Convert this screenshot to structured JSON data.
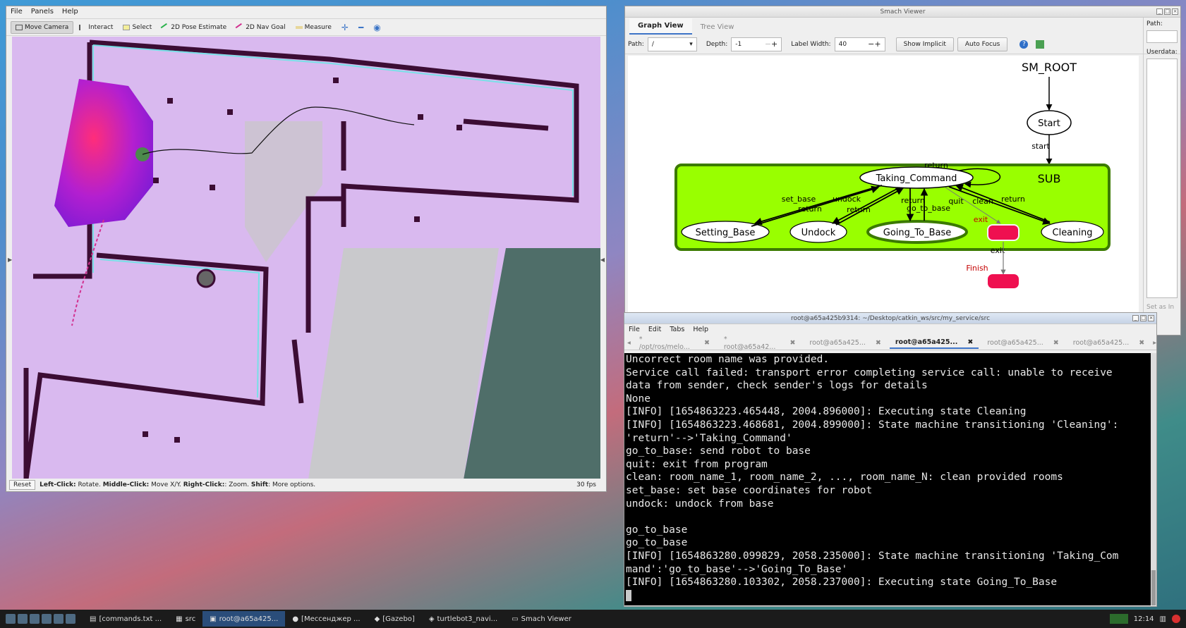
{
  "rviz": {
    "menu": [
      "File",
      "Panels",
      "Help"
    ],
    "tools": [
      {
        "label": "Move Camera",
        "icon": "camera-icon",
        "active": true
      },
      {
        "label": "Interact",
        "icon": "cursor-icon",
        "active": false
      },
      {
        "label": "Select",
        "icon": "select-box-icon",
        "active": false
      },
      {
        "label": "2D Pose Estimate",
        "icon": "green-arrow-icon",
        "active": false
      },
      {
        "label": "2D Nav Goal",
        "icon": "pink-arrow-icon",
        "active": false
      },
      {
        "label": "Measure",
        "icon": "ruler-icon",
        "active": false
      }
    ],
    "status_reset": "Reset",
    "status_parts": [
      {
        "bold": "Left-Click:",
        "text": " Rotate. "
      },
      {
        "bold": "Middle-Click:",
        "text": " Move X/Y. "
      },
      {
        "bold": "Right-Click:",
        "text": ": Zoom. "
      },
      {
        "bold": "Shift",
        "text": ": More options."
      }
    ],
    "fps": "30 fps"
  },
  "smach": {
    "title": "Smach Viewer",
    "tabs": [
      "Graph View",
      "Tree View"
    ],
    "path_label": "Path:",
    "path_value": "/",
    "depth_label": "Depth:",
    "depth_value": "-1",
    "label_width_label": "Label Width:",
    "label_width_value": "40",
    "show_implicit": "Show Implicit",
    "auto_focus": "Auto Focus",
    "side_path": "Path:",
    "side_userdata": "Userdata:",
    "side_hint": "Set as In",
    "graph": {
      "root": "SM_ROOT",
      "start": "Start",
      "start_edge": "start",
      "container": "SUB",
      "center": "Taking_Command",
      "states": [
        "Setting_Base",
        "Undock",
        "Going_To_Base",
        "Cleaning"
      ],
      "edge_labels": [
        "return",
        "set_base",
        "undock",
        "return",
        "return",
        "return",
        "go_to_base",
        "quit",
        "clean",
        "return",
        "exit",
        "exit"
      ],
      "finish": "Finish"
    }
  },
  "terminal": {
    "title": "root@a65a425b9314: ~/Desktop/catkin_ws/src/my_service/src",
    "menu": [
      "File",
      "Edit",
      "Tabs",
      "Help"
    ],
    "tabs": [
      {
        "label": "* /opt/ros/melo...",
        "active": false
      },
      {
        "label": "* root@a65a42...",
        "active": false
      },
      {
        "label": "root@a65a425...",
        "active": false
      },
      {
        "label": "root@a65a425...",
        "active": true
      },
      {
        "label": "root@a65a425...",
        "active": false
      },
      {
        "label": "root@a65a425...",
        "active": false
      }
    ],
    "lines": [
      "Uncorrect room name was provided.",
      "Service call failed: transport error completing service call: unable to receive",
      "data from sender, check sender's logs for details",
      "None",
      "[INFO] [1654863223.465448, 2004.896000]: Executing state Cleaning",
      "[INFO] [1654863223.468681, 2004.899000]: State machine transitioning 'Cleaning':",
      "'return'-->'Taking_Command'",
      "go_to_base: send robot to base",
      "quit: exit from program",
      "clean: room_name_1, room_name_2, ..., room_name_N: clean provided rooms",
      "set_base: set base coordinates for robot",
      "undock: undock from base",
      "",
      "go_to_base",
      "go_to_base",
      "[INFO] [1654863280.099829, 2058.235000]: State machine transitioning 'Taking_Com",
      "mand':'go_to_base'-->'Going_To_Base'",
      "[INFO] [1654863280.103302, 2058.237000]: Executing state Going_To_Base"
    ]
  },
  "taskbar": {
    "tasks": [
      {
        "label": "[commands.txt ...",
        "active": false
      },
      {
        "label": "src",
        "active": false
      },
      {
        "label": "root@a65a425...",
        "active": true
      },
      {
        "label": "[Мессенджер ...",
        "active": false
      },
      {
        "label": "[Gazebo]",
        "active": false
      },
      {
        "label": "turtlebot3_navi...",
        "active": false
      },
      {
        "label": "Smach Viewer",
        "active": false
      }
    ],
    "clock": "12:14"
  }
}
